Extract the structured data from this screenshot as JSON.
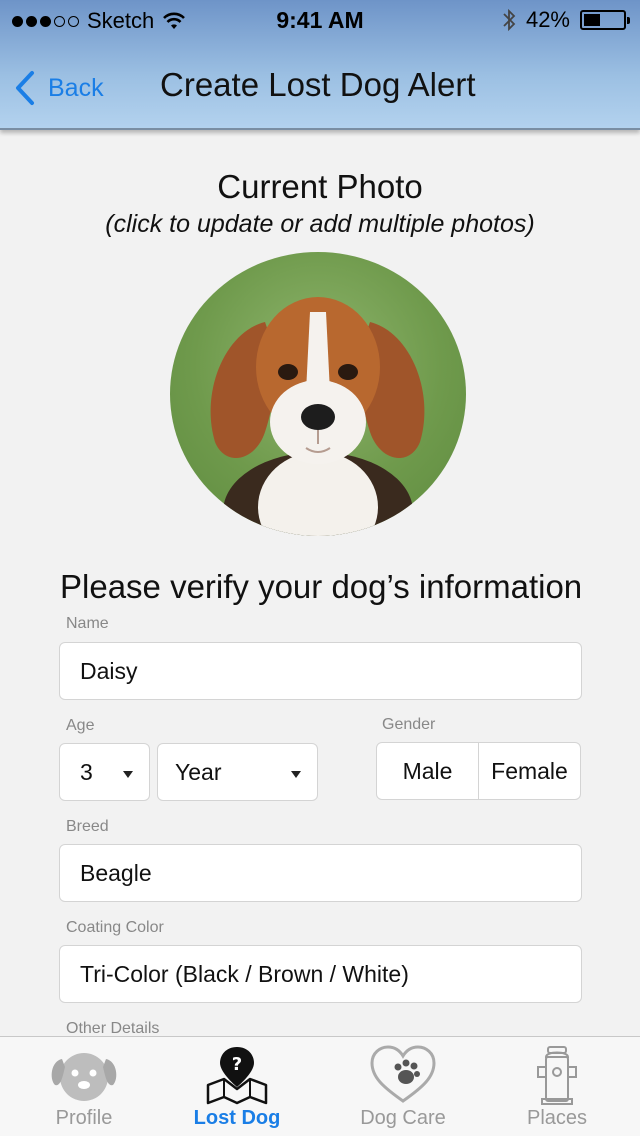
{
  "status_bar": {
    "carrier": "Sketch",
    "time": "9:41 AM",
    "battery": "42%",
    "icons": [
      "signal-dots-icon",
      "wifi-icon",
      "bluetooth-icon",
      "battery-icon"
    ]
  },
  "nav": {
    "back_label": "Back",
    "title": "Create Lost Dog Alert"
  },
  "photo": {
    "title": "Current Photo",
    "subtitle": "(click to update or add multiple photos)"
  },
  "form": {
    "section_title": "Please verify your dog’s information",
    "name_label": "Name",
    "name_value": "Daisy",
    "age_label": "Age",
    "age_value": "3",
    "age_unit": "Year",
    "gender_label": "Gender",
    "gender_options": [
      "Male",
      "Female"
    ],
    "breed_label": "Breed",
    "breed_value": "Beagle",
    "color_label": "Coating Color",
    "color_value": "Tri-Color (Black / Brown / White)",
    "other_label": "Other Details"
  },
  "tabs": [
    {
      "label": "Profile",
      "icon": "dog-face-icon",
      "active": false
    },
    {
      "label": "Lost Dog",
      "icon": "lost-dog-map-icon",
      "active": true
    },
    {
      "label": "Dog Care",
      "icon": "heart-paw-icon",
      "active": false
    },
    {
      "label": "Places",
      "icon": "fire-hydrant-icon",
      "active": false
    }
  ],
  "colors": {
    "accent": "#1a7ee6",
    "header_top": "#6e94c8",
    "header_bottom": "#b3d2ee",
    "background": "#f2f2f2"
  }
}
